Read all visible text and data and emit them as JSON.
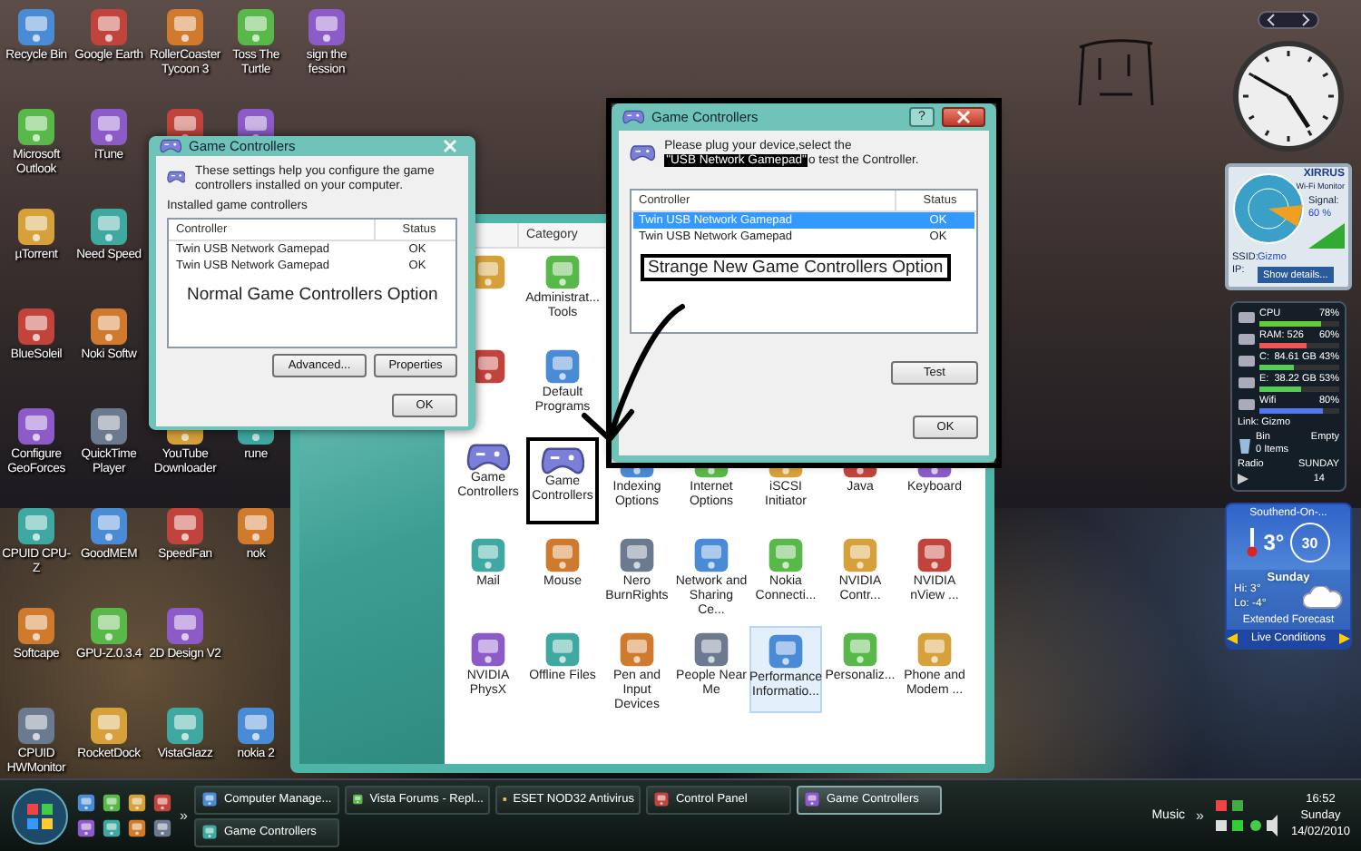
{
  "desktop": {
    "columns": [
      {
        "icons": [
          {
            "kind": "shortcut",
            "label": "Recycle Bin"
          },
          {
            "kind": "shortcut",
            "label": "Microsoft Outlook"
          },
          {
            "kind": "shortcut",
            "label": "µTorrent"
          },
          {
            "kind": "shortcut",
            "label": "BlueSoleil"
          },
          {
            "kind": "shortcut",
            "label": "Configure GeoForces"
          },
          {
            "kind": "shortcut",
            "label": "CPUID CPU-Z"
          },
          {
            "kind": "shortcut",
            "label": "Softcape"
          },
          {
            "kind": "shortcut",
            "label": "CPUID HWMonitor"
          }
        ]
      },
      {
        "icons": [
          {
            "kind": "shortcut",
            "label": "Google Earth"
          },
          {
            "kind": "shortcut",
            "label": "iTune"
          },
          {
            "kind": "shortcut",
            "label": "Need Speed"
          },
          {
            "kind": "shortcut",
            "label": "Noki Softw"
          },
          {
            "kind": "shortcut",
            "label": "QuickTime Player"
          },
          {
            "kind": "shortcut",
            "label": "GoodMEM"
          },
          {
            "kind": "shortcut",
            "label": "GPU-Z.0.3.4"
          },
          {
            "kind": "shortcut",
            "label": "RocketDock"
          }
        ]
      },
      {
        "icons": [
          {
            "kind": "shortcut",
            "label": "RollerCoaster Tycoon 3"
          },
          {
            "kind": "icon-only"
          },
          {
            "kind": "gap"
          },
          {
            "kind": "gap"
          },
          {
            "kind": "shortcut",
            "label": "YouTube Downloader"
          },
          {
            "kind": "shortcut",
            "label": "SpeedFan"
          },
          {
            "kind": "shortcut",
            "label": "2D Design V2"
          },
          {
            "kind": "shortcut",
            "label": "VistaGlazz"
          }
        ]
      },
      {
        "icons": [
          {
            "kind": "shortcut",
            "label": "Toss The Turtle"
          },
          {
            "kind": "icon-only"
          },
          {
            "kind": "gap"
          },
          {
            "kind": "gap"
          },
          {
            "kind": "shortcut",
            "label": "rune"
          },
          {
            "kind": "shortcut",
            "label": "nok"
          },
          {
            "kind": "gap"
          },
          {
            "kind": "shortcut",
            "label": "nokia 2"
          }
        ]
      },
      {
        "icons": [
          {
            "kind": "shortcut",
            "label": "sign the fession"
          }
        ]
      }
    ]
  },
  "control_panel": {
    "column_header": "Category",
    "rows": [
      {
        "items": [
          {
            "kind": "icon-only",
            "circled": false,
            "highlighted": false
          },
          {
            "kind": "item",
            "label": "Administrat... Tools",
            "circled": false,
            "highlighted": false
          }
        ]
      },
      {
        "items": [
          {
            "kind": "icon-only",
            "circled": false,
            "highlighted": false
          },
          {
            "kind": "item",
            "label": "Default Programs",
            "circled": false,
            "highlighted": false
          }
        ]
      },
      {
        "items": [
          {
            "kind": "item",
            "label": "Game Controllers",
            "circled": false,
            "highlighted": false
          },
          {
            "kind": "item",
            "label": "Game Controllers",
            "circled": true,
            "highlighted": false
          },
          {
            "kind": "item",
            "label": "Indexing Options",
            "circled": false,
            "highlighted": false
          },
          {
            "kind": "item",
            "label": "Internet Options",
            "circled": false,
            "highlighted": false
          },
          {
            "kind": "item",
            "label": "iSCSI Initiator",
            "circled": false,
            "highlighted": false
          },
          {
            "kind": "item",
            "label": "Java",
            "circled": false,
            "highlighted": false
          },
          {
            "kind": "item",
            "label": "Keyboard",
            "circled": false,
            "highlighted": false
          }
        ]
      },
      {
        "items": [
          {
            "kind": "item",
            "label": "Mail",
            "circled": false,
            "highlighted": false
          },
          {
            "kind": "item",
            "label": "Mouse",
            "circled": false,
            "highlighted": false
          },
          {
            "kind": "item",
            "label": "Nero BurnRights",
            "circled": false,
            "highlighted": false
          },
          {
            "kind": "item",
            "label": "Network and Sharing Ce...",
            "circled": false,
            "highlighted": false
          },
          {
            "kind": "item",
            "label": "Nokia Connecti...",
            "circled": false,
            "highlighted": false
          },
          {
            "kind": "item",
            "label": "NVIDIA Contr...",
            "circled": false,
            "highlighted": false
          },
          {
            "kind": "item",
            "label": "NVIDIA nView ...",
            "circled": false,
            "highlighted": false
          }
        ]
      },
      {
        "items": [
          {
            "kind": "item",
            "label": "NVIDIA PhysX",
            "circled": false,
            "highlighted": false
          },
          {
            "kind": "item",
            "label": "Offline Files",
            "circled": false,
            "highlighted": false
          },
          {
            "kind": "item",
            "label": "Pen and Input Devices",
            "circled": false,
            "highlighted": false
          },
          {
            "kind": "item",
            "label": "People Near Me",
            "circled": false,
            "highlighted": false
          },
          {
            "kind": "item",
            "label": "Performance Informatio...",
            "circled": false,
            "highlighted": true
          },
          {
            "kind": "item",
            "label": "Personaliz...",
            "circled": false,
            "highlighted": false
          },
          {
            "kind": "item",
            "label": "Phone and Modem ...",
            "circled": false,
            "highlighted": false
          }
        ]
      }
    ]
  },
  "left_dialog": {
    "title": "Game Controllers",
    "intro": "These settings help you configure the game controllers installed on your computer.",
    "list_label": "Installed game controllers",
    "columns": [
      "Controller",
      "Status"
    ],
    "controllers": [
      {
        "name": "Twin USB Network Gamepad",
        "status": "OK",
        "selected": false
      },
      {
        "name": "Twin USB Network Gamepad",
        "status": "OK",
        "selected": false
      }
    ],
    "annotation": "Normal Game Controllers Option",
    "buttons": [
      "Advanced...",
      "Properties"
    ],
    "ok": "OK"
  },
  "right_dialog": {
    "title": "Game Controllers",
    "help_button": "?",
    "intro_before": "Please plug your device,select the",
    "intro_highlight": "\"USB Network Gamepad\"",
    "intro_after": "o test the Controller.",
    "columns": [
      "Controller",
      "Status"
    ],
    "controllers": [
      {
        "name": "Twin USB Network Gamepad",
        "status": "OK",
        "selected": true
      },
      {
        "name": "Twin USB Network Gamepad",
        "status": "OK",
        "selected": false
      }
    ],
    "annotation": "Strange New Game Controllers Option",
    "test_button": "Test",
    "ok": "OK"
  },
  "gadgets": {
    "wifi": {
      "brand": "XIRRUS",
      "subtitle": "Wi-Fi Monitor",
      "signal_label": "Signal:",
      "signal": "60 %",
      "ssid_label": "SSID:",
      "ssid": "Gizmo",
      "ip_label": "IP:",
      "details": "Show details..."
    },
    "monitor": {
      "meters": [
        {
          "label": "CPU",
          "reading": "78%",
          "level": 0.78
        },
        {
          "label": "RAM: 526",
          "reading": "60%",
          "level": 0.6
        },
        {
          "label": "C:",
          "reading": "84.61 GB 43%",
          "level": 0.43
        },
        {
          "label": "E:",
          "reading": "38.22 GB 53%",
          "level": 0.53
        },
        {
          "label": "Wifi",
          "reading": "80%",
          "level": 0.8
        }
      ],
      "link": "Link: Gizmo",
      "bin_label": "Bin",
      "bin_state": "Empty",
      "bin_items": "0 Items",
      "radio": "Radio",
      "day": "SUNDAY",
      "date": "14"
    },
    "weather": {
      "location": "Southend-On-...",
      "temperature": "3°",
      "wind": "30",
      "day": "Sunday",
      "high": "Hi: 3°",
      "low": "Lo: -4°",
      "forecast": "Extended Forecast",
      "footer": "Live Conditions"
    }
  },
  "taskbar": {
    "button_rows": [
      {
        "buttons": [
          {
            "label": "Computer Manage...",
            "selected": false
          },
          {
            "label": "Vista Forums - Repl...",
            "selected": false
          },
          {
            "label": "ESET NOD32 Antivirus",
            "selected": false
          },
          {
            "label": "Control Panel",
            "selected": false
          },
          {
            "label": "Game Controllers",
            "selected": true
          }
        ]
      },
      {
        "buttons": [
          {
            "label": "Game Controllers",
            "selected": false
          }
        ]
      }
    ],
    "overflow": "»",
    "toolbar": "Music",
    "tray_overflow": "»",
    "time": "16:52",
    "day": "Sunday",
    "date": "14/02/2010"
  }
}
